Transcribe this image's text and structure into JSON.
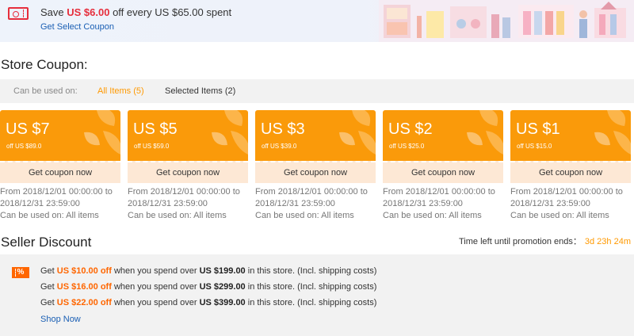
{
  "banner": {
    "prefix": "Save ",
    "amount": "US $6.00",
    "suffix": " off every US $65.00 spent",
    "link": "Get Select Coupon"
  },
  "store_coupon": {
    "title": "Store Coupon:",
    "filter_label": "Can be used on:",
    "filter_all": "All Items (5)",
    "filter_selected": "Selected Items (2)",
    "coupons": [
      {
        "amount": "US $7",
        "min": "off US $89.0",
        "button": "Get coupon now",
        "from": "From 2018/12/01 00:00:00 to",
        "to": "2018/12/31 23:59:00",
        "scope": "Can be used on: All items"
      },
      {
        "amount": "US $5",
        "min": "off US $59.0",
        "button": "Get coupon now",
        "from": "From 2018/12/01 00:00:00 to",
        "to": "2018/12/31 23:59:00",
        "scope": "Can be used on: All items"
      },
      {
        "amount": "US $3",
        "min": "off US $39.0",
        "button": "Get coupon now",
        "from": "From 2018/12/01 00:00:00 to",
        "to": "2018/12/31 23:59:00",
        "scope": "Can be used on: All items"
      },
      {
        "amount": "US $2",
        "min": "off US $25.0",
        "button": "Get coupon now",
        "from": "From 2018/12/01 00:00:00 to",
        "to": "2018/12/31 23:59:00",
        "scope": "Can be used on: All items"
      },
      {
        "amount": "US $1",
        "min": "off US $15.0",
        "button": "Get coupon now",
        "from": "From 2018/12/01 00:00:00 to",
        "to": "2018/12/31 23:59:00",
        "scope": "Can be used on: All items"
      }
    ]
  },
  "seller_discount": {
    "title": "Seller Discount",
    "timer_label": "Time left until promotion ends：",
    "timer_value": "3d 23h 24m",
    "icon_text": "%",
    "lines": [
      {
        "a": "Get ",
        "off": "US $10.00 off",
        "b": " when you spend over ",
        "min": "US $199.00",
        "c": " in this store. (Incl. shipping costs)"
      },
      {
        "a": "Get ",
        "off": "US $16.00 off",
        "b": " when you spend over ",
        "min": "US $299.00",
        "c": " in this store. (Incl. shipping costs)"
      },
      {
        "a": "Get ",
        "off": "US $22.00 off",
        "b": " when you spend over ",
        "min": "US $399.00",
        "c": " in this store. (Incl. shipping costs)"
      }
    ],
    "shop_now": "Shop Now"
  },
  "colors": {
    "accent_orange": "#fa9a0a",
    "price_red": "#e62e3c",
    "link_blue": "#1a5fb4",
    "discount_orange": "#ff6600"
  }
}
